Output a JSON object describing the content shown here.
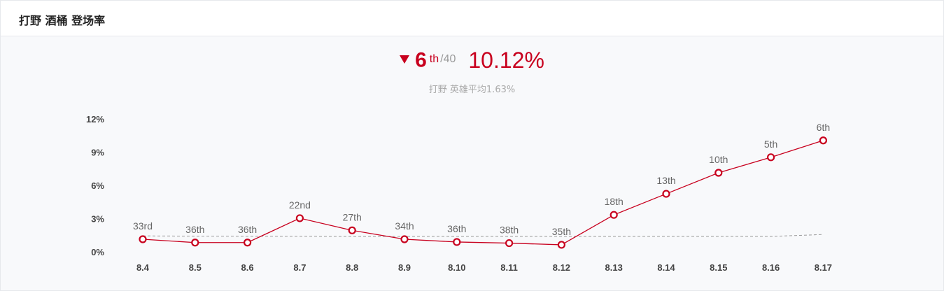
{
  "header": {
    "title": "打野 酒桶 登场率"
  },
  "summary": {
    "trend": "down",
    "trend_icon": "triangle-down-icon",
    "rank": "6",
    "rank_suffix": "th",
    "rank_total": "/40",
    "rate": "10.12%",
    "average_text": "打野 英雄平均1.63%"
  },
  "colors": {
    "accent": "#c8001e",
    "average_line": "#9a9a9a",
    "background": "#f8f9fb"
  },
  "chart_data": {
    "type": "line",
    "title": "",
    "xlabel": "",
    "ylabel": "",
    "categories": [
      "8.4",
      "8.5",
      "8.6",
      "8.7",
      "8.8",
      "8.9",
      "8.10",
      "8.11",
      "8.12",
      "8.13",
      "8.14",
      "8.15",
      "8.16",
      "8.17"
    ],
    "ylim": [
      0,
      12
    ],
    "yticks": [
      0,
      3,
      6,
      9,
      12
    ],
    "ytick_labels": [
      "0%",
      "3%",
      "6%",
      "9%",
      "12%"
    ],
    "grid": false,
    "legend": "none",
    "series": [
      {
        "values": [
          1.2,
          0.9,
          0.9,
          3.1,
          2.0,
          1.2,
          0.95,
          0.85,
          0.7,
          3.4,
          5.3,
          7.2,
          8.6,
          10.12
        ],
        "labels": [
          "33rd",
          "36th",
          "36th",
          "22nd",
          "27th",
          "34th",
          "36th",
          "38th",
          "35th",
          "18th",
          "13th",
          "10th",
          "5th",
          "6th"
        ],
        "style": "solid-with-hollow-markers"
      },
      {
        "values": [
          1.5,
          1.48,
          1.47,
          1.46,
          1.45,
          1.45,
          1.45,
          1.45,
          1.45,
          1.45,
          1.45,
          1.45,
          1.45,
          1.63
        ],
        "style": "dashed"
      }
    ]
  }
}
